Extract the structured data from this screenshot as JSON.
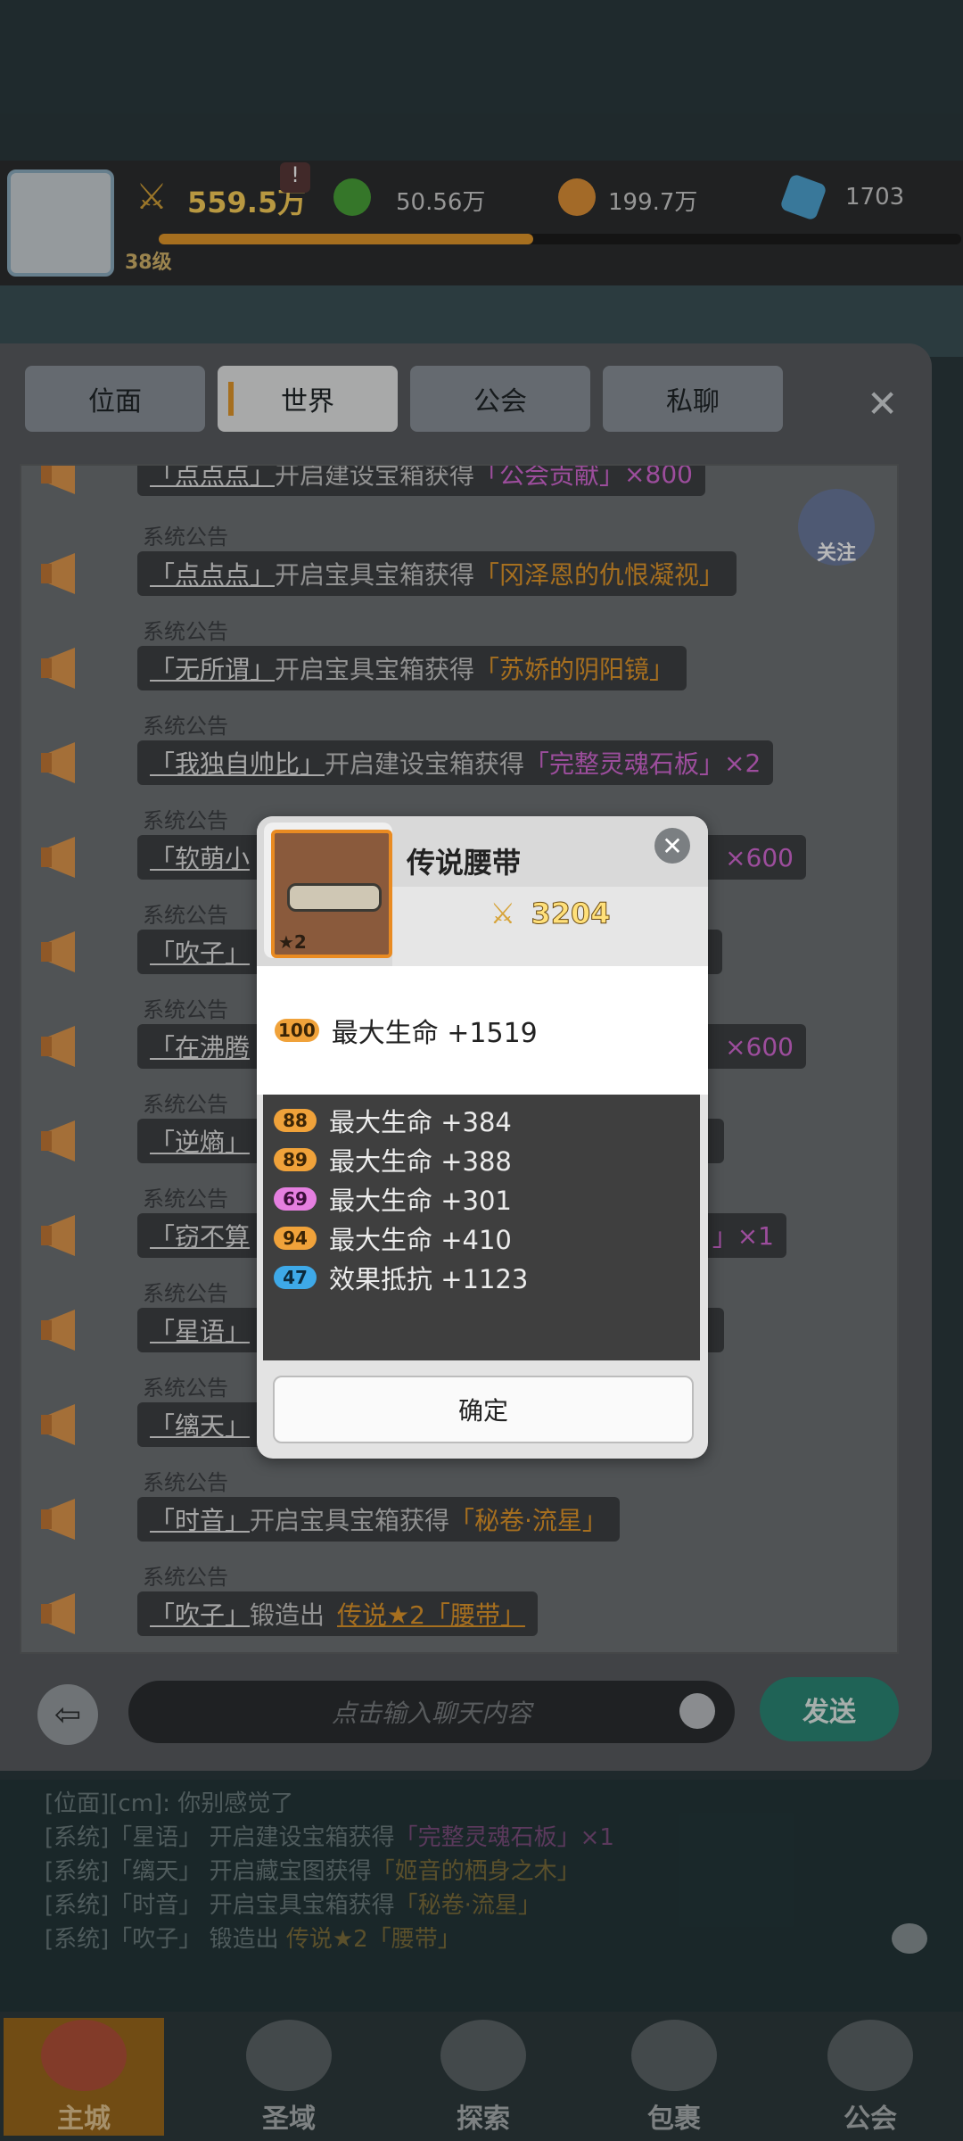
{
  "player": {
    "level": "38级",
    "power": "559.5万",
    "resources": [
      "50.56万",
      "199.7万",
      "1703"
    ]
  },
  "tabs": [
    {
      "label": "位面"
    },
    {
      "label": "世界"
    },
    {
      "label": "公会"
    },
    {
      "label": "私聊"
    }
  ],
  "follow_label": "关注",
  "system_label": "系统公告",
  "messages": [
    {
      "name": "「点点点」",
      "action": "开启建设宝箱获得",
      "reward": "「公会贡献」",
      "extra": "×800",
      "reward_color": "p"
    },
    {
      "name": "「点点点」",
      "action": "开启宝具宝箱获得",
      "reward": "「冈泽恩的仇恨凝视」",
      "extra": "",
      "reward_color": "o"
    },
    {
      "name": "「无所谓」",
      "action": "开启宝具宝箱获得",
      "reward": "「苏娇的阴阳镜」",
      "extra": "",
      "reward_color": "o"
    },
    {
      "name": "「我独自帅比」",
      "action": "开启建设宝箱获得",
      "reward": "「完整灵魂石板」",
      "extra": "×2",
      "reward_color": "p"
    },
    {
      "name": "「软萌小",
      "action": "",
      "reward": "",
      "extra": "×600",
      "reward_color": "p"
    },
    {
      "name": "「吹子」",
      "action": "",
      "reward": "",
      "extra": "",
      "reward_color": "o"
    },
    {
      "name": "「在沸腾",
      "action": "",
      "reward": "",
      "extra": "×600",
      "reward_color": "p"
    },
    {
      "name": "「逆熵」",
      "action": "",
      "reward": "",
      "extra": "",
      "reward_color": "o"
    },
    {
      "name": "「窃不算",
      "action": "",
      "reward": "」",
      "extra": "×1",
      "reward_color": "p"
    },
    {
      "name": "「星语」",
      "action": "",
      "reward": "",
      "extra": "",
      "reward_color": "o"
    },
    {
      "name": "「缡天」",
      "action": "",
      "reward": "",
      "extra": "",
      "reward_color": "o"
    },
    {
      "name": "「时音」",
      "action": "开启宝具宝箱获得",
      "reward": "「秘卷·流星」",
      "extra": "",
      "reward_color": "o"
    },
    {
      "name": "「吹子」",
      "action": "锻造出",
      "reward": "传说★2「腰带」",
      "extra": "",
      "reward_color": "o"
    }
  ],
  "input_placeholder": "点击输入聊天内容",
  "send_label": "发送",
  "log": [
    {
      "prefix": "[位面][cm]:",
      "name": "",
      "text": "你别感觉了",
      "reward": "",
      "extra": ""
    },
    {
      "prefix": "[系统]",
      "name": "「星语」",
      "text": "开启建设宝箱获得",
      "reward": "「完整灵魂石板」",
      "extra": "×1"
    },
    {
      "prefix": "[系统]",
      "name": "「缡天」",
      "text": "开启藏宝图获得",
      "reward": "「姬音的栖身之木」",
      "extra": ""
    },
    {
      "prefix": "[系统]",
      "name": "「时音」",
      "text": "开启宝具宝箱获得",
      "reward": "「秘卷·流星」",
      "extra": ""
    },
    {
      "prefix": "[系统]",
      "name": "「吹子」",
      "text": "锻造出",
      "reward": "传说★2「腰带」",
      "extra": ""
    }
  ],
  "nav": [
    {
      "label": "主城"
    },
    {
      "label": "圣域"
    },
    {
      "label": "探索"
    },
    {
      "label": "包裹"
    },
    {
      "label": "公会"
    }
  ],
  "modal": {
    "item_name": "传说腰带",
    "stars": "★2",
    "power": "3204",
    "main_stat": {
      "level": "100",
      "text": "最大生命 +1519"
    },
    "sub_stats": [
      {
        "level": "88",
        "text": "最大生命 +384",
        "color": "orange"
      },
      {
        "level": "89",
        "text": "最大生命 +388",
        "color": "orange"
      },
      {
        "level": "69",
        "text": "最大生命 +301",
        "color": "pink"
      },
      {
        "level": "94",
        "text": "最大生命 +410",
        "color": "orange"
      },
      {
        "level": "47",
        "text": "效果抵抗 +1123",
        "color": "blue"
      }
    ],
    "confirm_label": "确定"
  }
}
